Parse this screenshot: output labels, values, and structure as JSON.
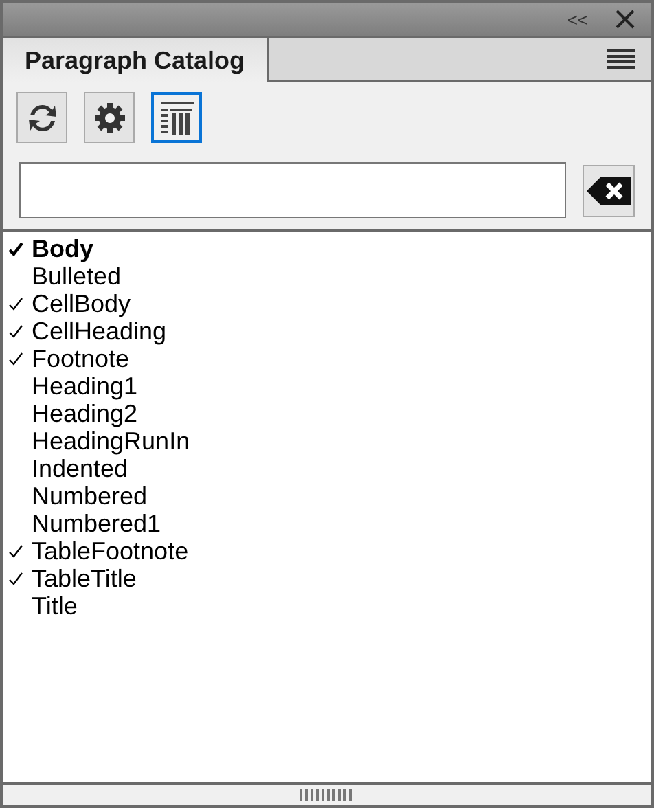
{
  "title_bar": {
    "collapse_button": "<<"
  },
  "tabs": [
    {
      "label": "Paragraph Catalog",
      "selected": true
    }
  ],
  "toolbar": [
    {
      "kind": "refresh",
      "selected": false
    },
    {
      "kind": "settings",
      "selected": false
    },
    {
      "kind": "delete",
      "selected": true
    }
  ],
  "styles": [
    {
      "name": "Body",
      "checked": true,
      "selected": true
    },
    {
      "name": "Bulleted",
      "checked": false,
      "selected": false
    },
    {
      "name": "CellBody",
      "checked": true,
      "selected": false
    },
    {
      "name": "CellHeading",
      "checked": true,
      "selected": false
    },
    {
      "name": "Footnote",
      "checked": true,
      "selected": false
    },
    {
      "name": "Heading1",
      "checked": false,
      "selected": false
    },
    {
      "name": "Heading2",
      "checked": false,
      "selected": false
    },
    {
      "name": "HeadingRunIn",
      "checked": false,
      "selected": false
    },
    {
      "name": "Indented",
      "checked": false,
      "selected": false
    },
    {
      "name": "Numbered",
      "checked": false,
      "selected": false
    },
    {
      "name": "Numbered1",
      "checked": false,
      "selected": false
    },
    {
      "name": "TableFootnote",
      "checked": true,
      "selected": false
    },
    {
      "name": "TableTitle",
      "checked": true,
      "selected": false
    },
    {
      "name": "Title",
      "checked": false,
      "selected": false
    }
  ]
}
